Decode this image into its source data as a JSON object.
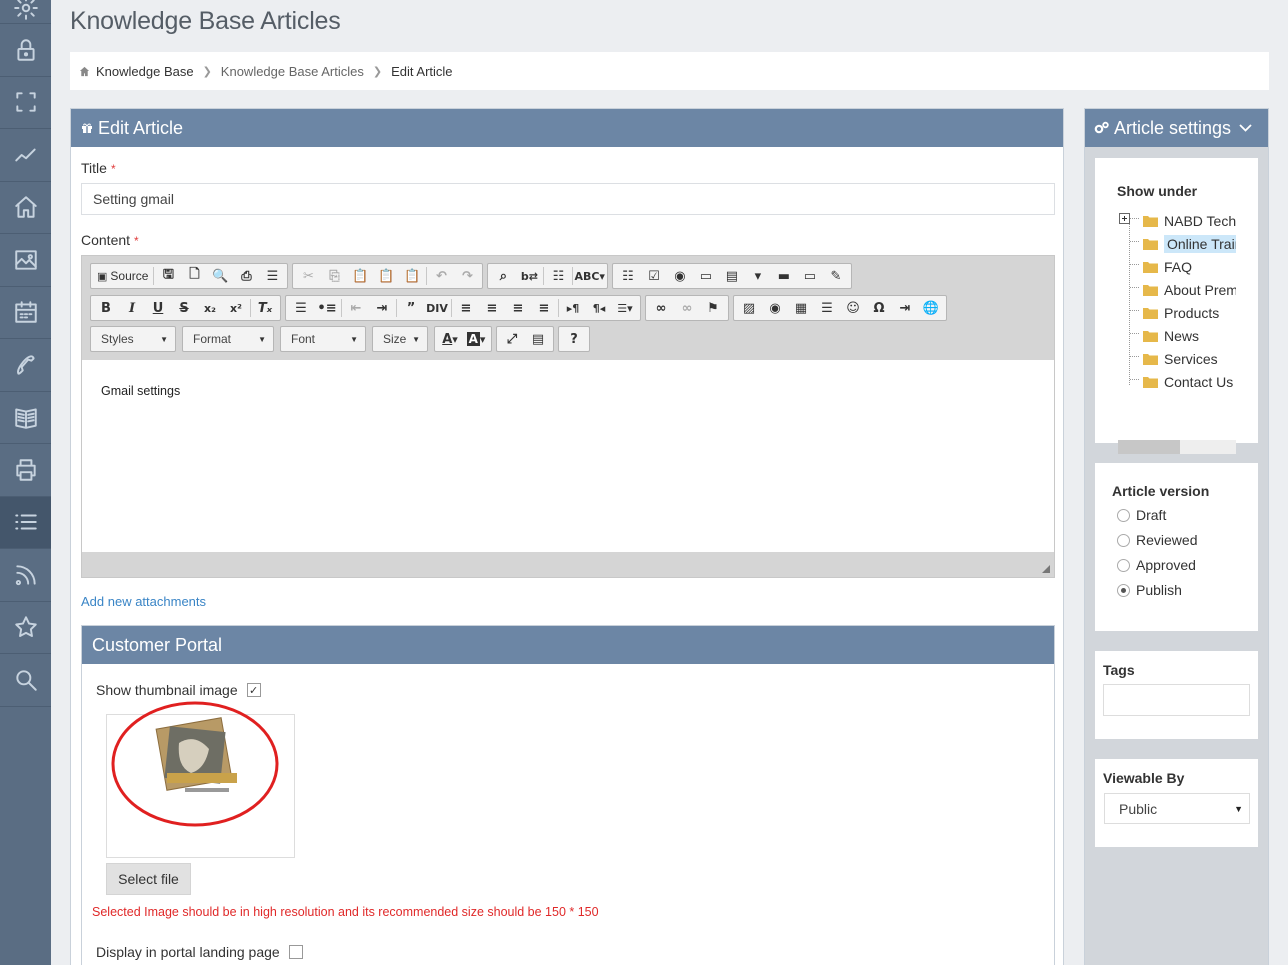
{
  "page": {
    "title": "Knowledge Base Articles"
  },
  "breadcrumb": {
    "items": [
      "Knowledge Base",
      "Knowledge Base Articles",
      "Edit Article"
    ]
  },
  "rail": {
    "icons": [
      "gear-icon",
      "lock-icon",
      "expand-icon",
      "chart-line-icon",
      "home-icon",
      "image-icon",
      "calendar-icon",
      "phone-icon",
      "book-icon",
      "print-icon",
      "list-icon",
      "rss-icon",
      "star-icon",
      "search-icon"
    ],
    "active": "list-icon",
    "color": "#5a6d83"
  },
  "edit": {
    "header": "Edit Article",
    "title_label": "Title",
    "title_value": "Setting gmail",
    "content_label": "Content",
    "required_mark": "*",
    "content_text": "Gmail settings",
    "toolbar": {
      "source_label": "Source",
      "styles": "Styles",
      "format": "Format",
      "font": "Font",
      "size": "Size",
      "help": "?"
    },
    "attach_link": "Add new attachments"
  },
  "portal": {
    "header": "Customer Portal",
    "thumbnail_label": "Show thumbnail image",
    "thumbnail_checked": true,
    "select_file": "Select file",
    "warning": "Selected Image should be in high resolution and its recommended size should be 150 * 150",
    "landing_label": "Display in portal landing page",
    "landing_checked": false
  },
  "settings": {
    "header": "Article settings",
    "show_under_title": "Show under",
    "tree": [
      "NABD Techi",
      "Online Trair",
      "FAQ",
      "About Prem",
      "Products",
      "News",
      "Services",
      "Contact Us"
    ],
    "tree_selected": "Online Trair",
    "version_title": "Article version",
    "versions": [
      "Draft",
      "Reviewed",
      "Approved",
      "Publish"
    ],
    "version_selected": "Publish",
    "tags_title": "Tags",
    "viewable_title": "Viewable By",
    "viewable_value": "Public"
  },
  "colors": {
    "accent": "#6c86a5",
    "link": "#3a85c6",
    "warning": "#e02929",
    "highlight_circle": "#e02020"
  }
}
